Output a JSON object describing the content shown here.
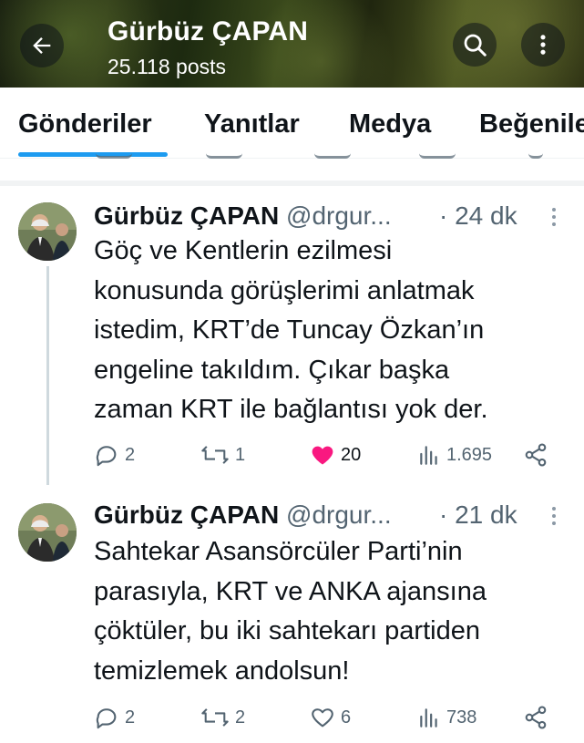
{
  "header": {
    "title": "Gürbüz ÇAPAN",
    "posts_count": "25.118 posts"
  },
  "tabs": [
    {
      "label": "Gönderiler",
      "active": true
    },
    {
      "label": "Yanıtlar",
      "active": false
    },
    {
      "label": "Medya",
      "active": false
    },
    {
      "label": "Beğeniler",
      "active": false
    }
  ],
  "posts": [
    {
      "name": "Gürbüz ÇAPAN",
      "handle": "@drgur...",
      "time": "· 24 dk",
      "lines": [
        "Göç ve Kentlerin ezilmesi",
        "konusunda görüşlerimi anlatmak",
        "istedim, KRT’de Tuncay Özkan’ın",
        "engeline takıldım. Çıkar başka",
        "zaman KRT ile bağlantısı yok der."
      ],
      "replies": "2",
      "reposts": "1",
      "likes": "20",
      "liked": true,
      "views": "1.695"
    },
    {
      "name": "Gürbüz ÇAPAN",
      "handle": "@drgur...",
      "time": "· 21 dk",
      "lines": [
        "Sahtekar Asansörcüler Parti’nin",
        "parasıyla, KRT ve ANKA ajansına",
        "çöktüler, bu iki sahtekarı partiden",
        "temizlemek andolsun!"
      ],
      "replies": "2",
      "reposts": "2",
      "likes": "6",
      "liked": false,
      "views": "738"
    }
  ],
  "colors": {
    "accent": "#1d9bf0",
    "like": "#f91880",
    "muted": "#536471"
  }
}
